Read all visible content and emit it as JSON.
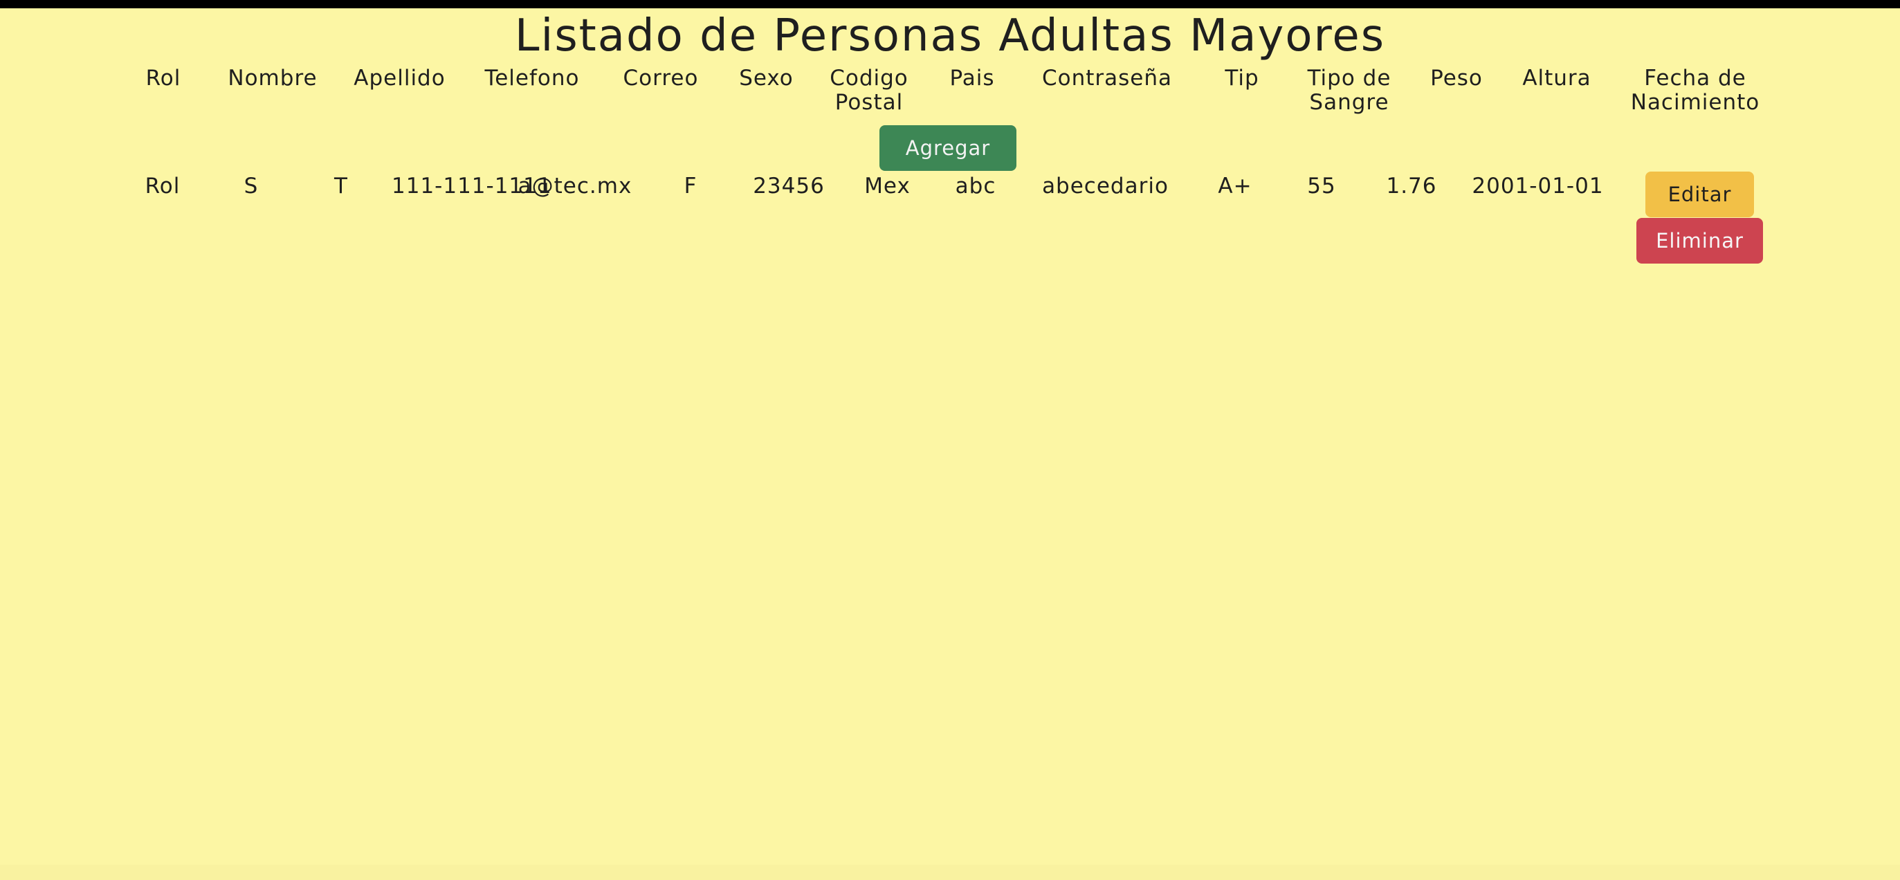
{
  "page": {
    "title": "Listado de Personas Adultas Mayores"
  },
  "table": {
    "headers": [
      "Rol",
      "Nombre",
      "Apellido",
      "Telefono",
      "Correo",
      "Sexo",
      "Codigo Postal",
      "Pais",
      "Contraseña",
      "Tip",
      "Tipo de Sangre",
      "Peso",
      "Altura",
      "Fecha de Nacimiento"
    ],
    "rows": [
      {
        "cells": [
          "Rol",
          "S",
          "T",
          "111-111-1111",
          "a@tec.mx",
          "F",
          "23456",
          "Mex",
          "abc",
          "abecedario",
          "A+",
          "55",
          "1.76",
          "2001-01-01"
        ],
        "edit_label": "Editar",
        "delete_label": "Eliminar"
      }
    ],
    "add_label": "Agregar"
  },
  "colors": {
    "background": "#fcf6a4",
    "add_button": "#3d8755",
    "edit_button": "#f2c047",
    "delete_button": "#cd4450",
    "text": "#1f1f1f"
  }
}
